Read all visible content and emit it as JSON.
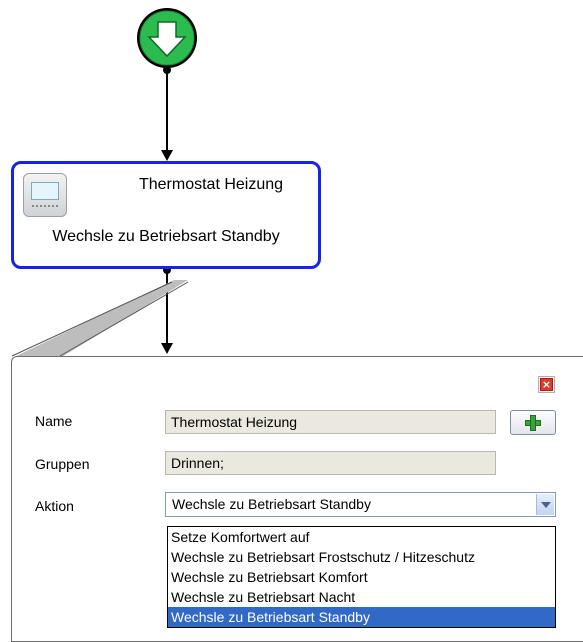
{
  "node": {
    "title": "Thermostat Heizung",
    "action": "Wechsle zu Betriebsart Standby"
  },
  "editor": {
    "name_label": "Name",
    "name_value": "Thermostat Heizung",
    "groups_label": "Gruppen",
    "groups_value": "Drinnen;",
    "action_label": "Aktion",
    "action_value": "Wechsle zu Betriebsart Standby",
    "options": [
      "Setze Komfortwert auf",
      "Wechsle zu Betriebsart Frostschutz / Hitzeschutz",
      "Wechsle zu Betriebsart Komfort",
      "Wechsle zu Betriebsart Nacht",
      "Wechsle zu Betriebsart Standby"
    ]
  },
  "colors": {
    "node_border": "#1524e8",
    "start_green": "#26b34a",
    "selection": "#3169c6"
  },
  "icons": {
    "start": "down-arrow-icon",
    "device": "thermostat-icon",
    "close": "close-icon",
    "add": "plus-icon"
  }
}
